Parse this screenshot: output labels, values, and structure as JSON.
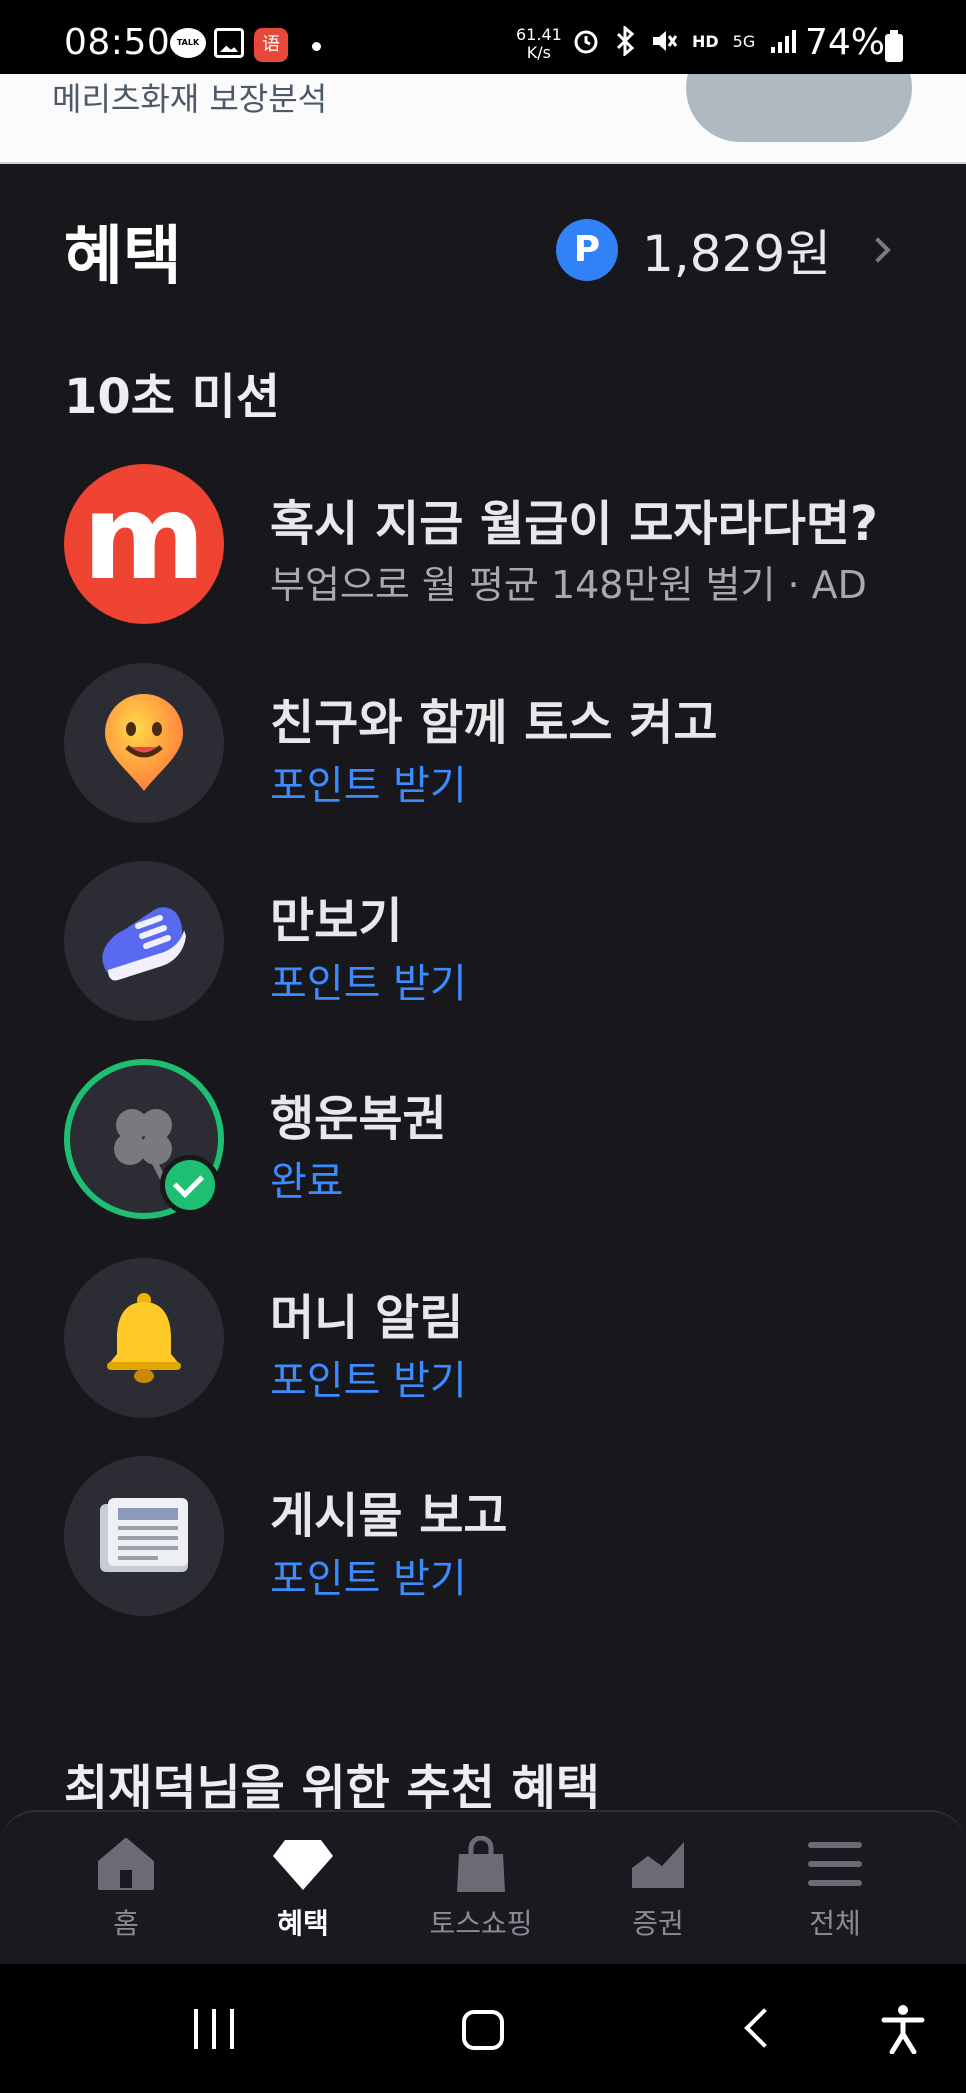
{
  "status_bar": {
    "time": "08:50",
    "talk_label": "TALK",
    "app_badge": "语",
    "network_speed": "61.41\nK/s",
    "network_type": "5G",
    "hd_label": "HD",
    "battery_percent": "74%"
  },
  "top_remnant": {
    "text": "메리츠화재 보장분석"
  },
  "header": {
    "title": "혜택",
    "points_badge": "P",
    "points_amount": "1,829원"
  },
  "missions_section": {
    "title": "10초 미션",
    "items": [
      {
        "title": "혹시 지금 월급이 모자라다면?",
        "subtitle": "부업으로 월 평균 148만원 벌기 · AD",
        "icon": "m-logo-icon",
        "icon_text": "m"
      },
      {
        "title": "친구와 함께 토스 켜고",
        "subtitle": "포인트 받기",
        "icon": "smiley-pin-icon"
      },
      {
        "title": "만보기",
        "subtitle": "포인트 받기",
        "icon": "sneaker-icon"
      },
      {
        "title": "행운복권",
        "subtitle": "완료",
        "icon": "clover-icon",
        "status": "completed"
      },
      {
        "title": "머니 알림",
        "subtitle": "포인트 받기",
        "icon": "bell-icon"
      },
      {
        "title": "게시물 보고",
        "subtitle": "포인트 받기",
        "icon": "newspaper-icon"
      }
    ]
  },
  "recommend_section": {
    "title": "최재덕님을 위한 추천 혜택"
  },
  "tab_bar": {
    "tabs": [
      {
        "label": "홈",
        "icon": "home-icon",
        "active": false
      },
      {
        "label": "혜택",
        "icon": "diamond-icon",
        "active": true
      },
      {
        "label": "토스쇼핑",
        "icon": "shopping-bag-icon",
        "active": false
      },
      {
        "label": "증권",
        "icon": "stock-chart-icon",
        "active": false
      },
      {
        "label": "전체",
        "icon": "menu-icon",
        "active": false
      }
    ]
  },
  "colors": {
    "background": "#17171c",
    "accent_blue": "#3c8cff",
    "points_badge": "#3182f6",
    "completed_green": "#1fbf73",
    "ad_logo_red": "#f04433"
  }
}
